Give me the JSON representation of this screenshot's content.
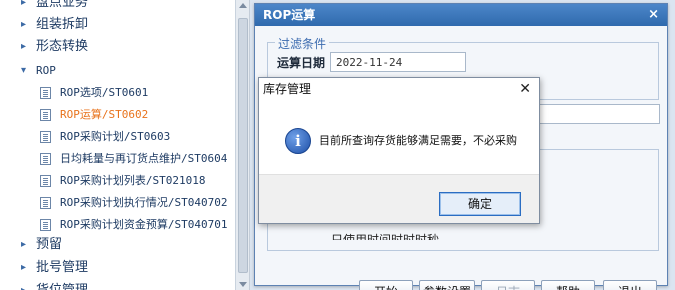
{
  "sidebar": {
    "items": [
      {
        "label": "盘点业务",
        "arrow": "▸",
        "type": "group"
      },
      {
        "label": "组装拆卸",
        "arrow": "▸",
        "type": "group"
      },
      {
        "label": "形态转换",
        "arrow": "▸",
        "type": "group"
      },
      {
        "label": "ROP",
        "arrow": "▾",
        "type": "group"
      },
      {
        "label": "ROP选项/ST0601",
        "type": "child"
      },
      {
        "label": "ROP运算/ST0602",
        "type": "child",
        "active": true
      },
      {
        "label": "ROP采购计划/ST0603",
        "type": "child"
      },
      {
        "label": "日均耗量与再订货点维护/ST0604",
        "type": "child"
      },
      {
        "label": "ROP采购计划列表/ST021018",
        "type": "child"
      },
      {
        "label": "ROP采购计划执行情况/ST040702",
        "type": "child"
      },
      {
        "label": "ROP采购计划资金预算/ST040701",
        "type": "child"
      },
      {
        "label": "预留",
        "arrow": "▸",
        "type": "group"
      },
      {
        "label": "批号管理",
        "arrow": "▸",
        "type": "group"
      },
      {
        "label": "货位管理",
        "arrow": "▸",
        "type": "group"
      }
    ]
  },
  "rop_window": {
    "title": "ROP运算",
    "close": "×",
    "filter_legend": "过滤条件",
    "date_label": "运算日期",
    "date_value": "2022-11-24",
    "partial_text": "只使用时间时时时秒",
    "buttons": {
      "start": "开始",
      "params": "参数设置",
      "log": "日志",
      "help": "帮助",
      "exit": "退出"
    }
  },
  "message_box": {
    "title": "库存管理",
    "close": "✕",
    "icon": "i",
    "text": "目前所查询存货能够满足需要，不必采购",
    "ok": "确定"
  },
  "colors": {
    "titlebar": "#2f6aad",
    "active_link": "#e8731c",
    "tree_text": "#1e3b63"
  }
}
